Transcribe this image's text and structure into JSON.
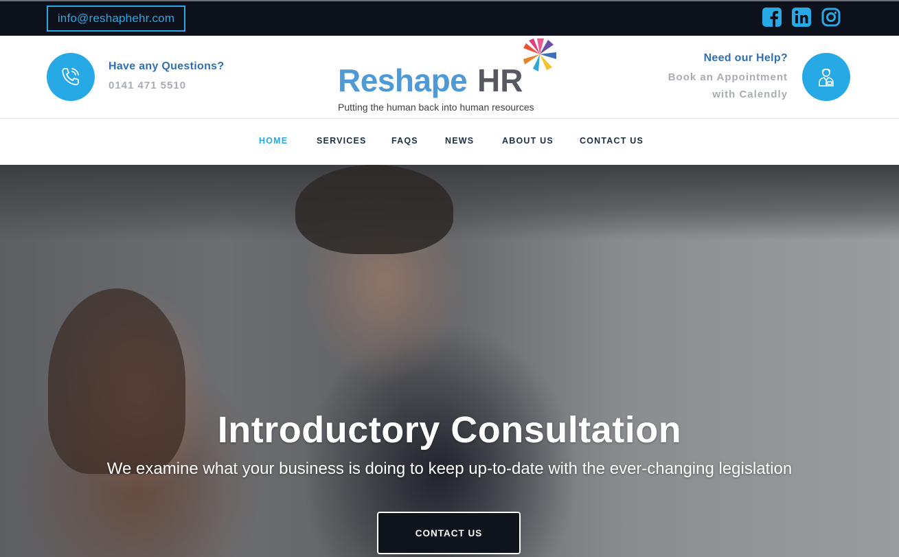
{
  "topbar": {
    "email": "info@reshaphehr.com",
    "social": [
      {
        "icon": "facebook-icon"
      },
      {
        "icon": "linkedin-icon"
      },
      {
        "icon": "instagram-icon"
      }
    ]
  },
  "header": {
    "questions_title": "Have any Questions?",
    "phone": "0141 471 5510",
    "help_title": "Need our Help?",
    "help_line1": "Book an Appointment",
    "help_line2": "with Calendly",
    "logo_word1": "Reshape",
    "logo_word2": "HR",
    "logo_tagline": "Putting the human back into human resources",
    "left_icon": "phone-icon",
    "right_icon": "consultant-icon"
  },
  "nav": {
    "items": [
      {
        "label": "HOME",
        "active": true
      },
      {
        "label": "SERVICES"
      },
      {
        "label": "FAQS"
      },
      {
        "label": "NEWS"
      },
      {
        "label": "ABOUT US"
      },
      {
        "label": "CONTACT US"
      }
    ]
  },
  "hero": {
    "title": "Introductory Consultation",
    "subtitle": "We examine what your business is doing to keep up-to-date with the ever-changing legislation",
    "button": "CONTACT US"
  },
  "colors": {
    "accent": "#27a9e5",
    "heading_blue": "#2f6fb2",
    "topbar_bg": "#0d111c",
    "muted": "#a8acb3",
    "logo_blue": "#4f9ad6",
    "logo_grey": "#565a60"
  }
}
